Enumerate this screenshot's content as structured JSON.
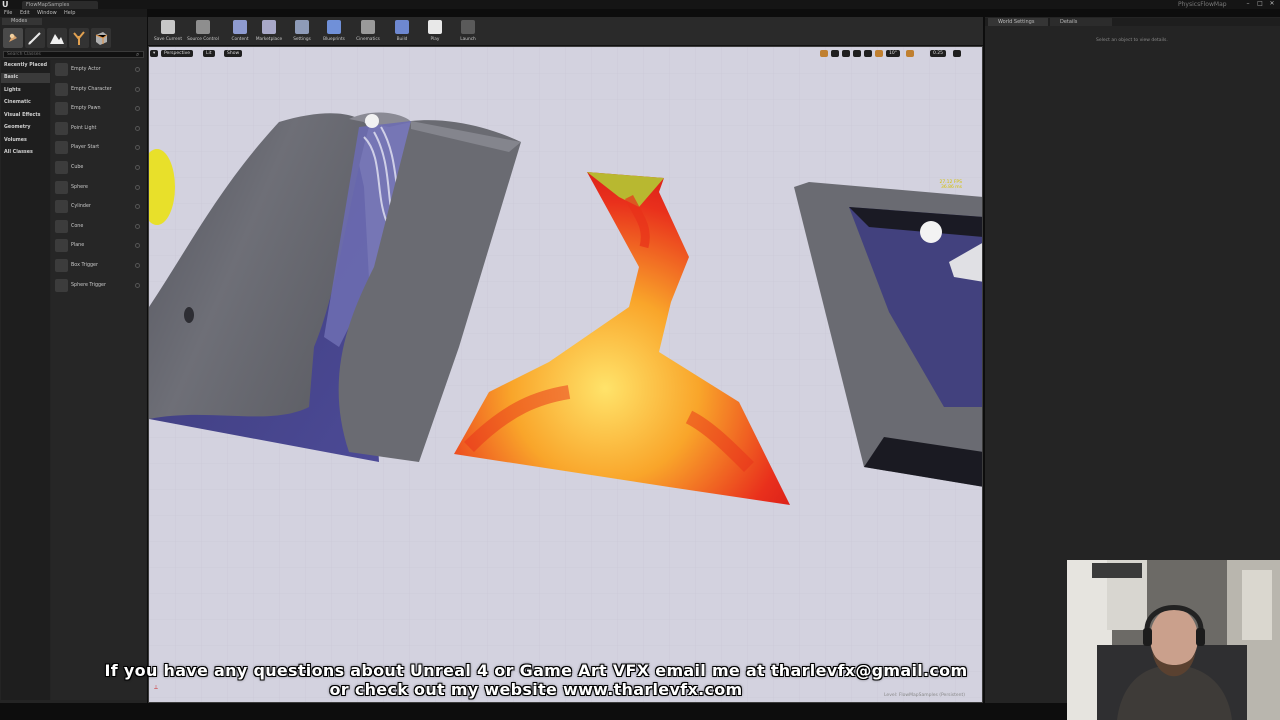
{
  "window": {
    "tab_title": "FlowMapSamples",
    "project": "PhysicsFlowMap",
    "controls": [
      "–",
      "□",
      "✕"
    ]
  },
  "menu": [
    "File",
    "Edit",
    "Window",
    "Help"
  ],
  "modes": {
    "tab_label": "Modes",
    "search_placeholder": "Search Classes",
    "categories": [
      "Recently Placed",
      "Basic",
      "Lights",
      "Cinematic",
      "Visual Effects",
      "Geometry",
      "Volumes",
      "All Classes"
    ],
    "active_category": "Basic",
    "placements": [
      "Empty Actor",
      "Empty Character",
      "Empty Pawn",
      "Point Light",
      "Player Start",
      "Cube",
      "Sphere",
      "Cylinder",
      "Cone",
      "Plane",
      "Box Trigger",
      "Sphere Trigger"
    ]
  },
  "toolbar": [
    {
      "label": "Save Current",
      "icon": "save-icon",
      "color": "#c7c7c7"
    },
    {
      "label": "Source Control",
      "icon": "source-control-icon",
      "color": "#8e8e8e"
    },
    {
      "label": "Content",
      "icon": "content-icon",
      "color": "#8e9bd0"
    },
    {
      "label": "Marketplace",
      "icon": "marketplace-icon",
      "color": "#a8a8c8"
    },
    {
      "label": "Settings",
      "icon": "gear-icon",
      "color": "#8e9bb8"
    },
    {
      "label": "Blueprints",
      "icon": "blueprint-icon",
      "color": "#7090d8"
    },
    {
      "label": "Cinematics",
      "icon": "clapper-icon",
      "color": "#9a9a9a"
    },
    {
      "label": "Build",
      "icon": "build-icon",
      "color": "#6e88d0"
    },
    {
      "label": "Play",
      "icon": "play-icon",
      "color": "#e8e8e8"
    },
    {
      "label": "Launch",
      "icon": "launch-icon",
      "color": "#5a5a5a"
    }
  ],
  "viewport": {
    "perspective_label": "Perspective",
    "lit_label": "Lit",
    "show_label": "Show",
    "fps": "27.12 FPS",
    "ms": "36.86 ms",
    "snap_angle": "10°",
    "camera_speed": "0.25",
    "level": "Level: FlowMapSamples (Persistent)"
  },
  "right_panel": {
    "tabs": [
      "World Settings",
      "Details"
    ],
    "details_message": "Select an object to view details."
  },
  "subtitles": {
    "line1": "If you have any questions about Unreal 4 or Game Art VFX email me at tharlevfx@gmail.com",
    "line2": "or check out my website www.tharlevfx.com"
  }
}
